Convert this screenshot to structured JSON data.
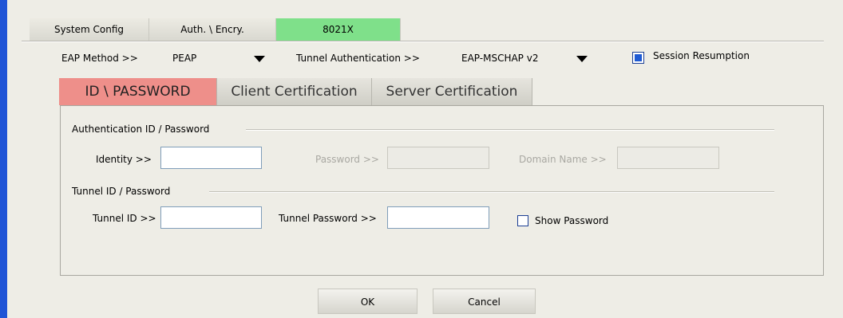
{
  "top_tabs": [
    {
      "label": "System Config"
    },
    {
      "label": "Auth. \\ Encry."
    },
    {
      "label": "8021X"
    }
  ],
  "eap": {
    "method_label": "EAP Method >>",
    "method_value": "PEAP",
    "tunnel_auth_label": "Tunnel Authentication >>",
    "tunnel_auth_value": "EAP-MSCHAP v2",
    "session_resumption_label": "Session Resumption",
    "session_resumption_checked": true
  },
  "inner_tabs": [
    {
      "label": "ID \\ PASSWORD"
    },
    {
      "label": "Client Certification"
    },
    {
      "label": "Server Certification"
    }
  ],
  "auth_group": {
    "title": "Authentication ID / Password",
    "identity_label": "Identity >>",
    "identity_value": "",
    "password_label": "Password >>",
    "password_value": "",
    "domain_label": "Domain Name >>",
    "domain_value": ""
  },
  "tunnel_group": {
    "title": "Tunnel ID / Password",
    "tunnel_id_label": "Tunnel ID >>",
    "tunnel_id_value": "",
    "tunnel_password_label": "Tunnel Password >>",
    "tunnel_password_value": "",
    "show_password_label": "Show Password",
    "show_password_checked": false
  },
  "buttons": {
    "ok_label": "OK",
    "cancel_label": "Cancel"
  },
  "colors": {
    "active_top_tab": "#7fe08a",
    "active_inner_tab": "#ee8f8a",
    "accent_blue": "#1f54d6"
  }
}
